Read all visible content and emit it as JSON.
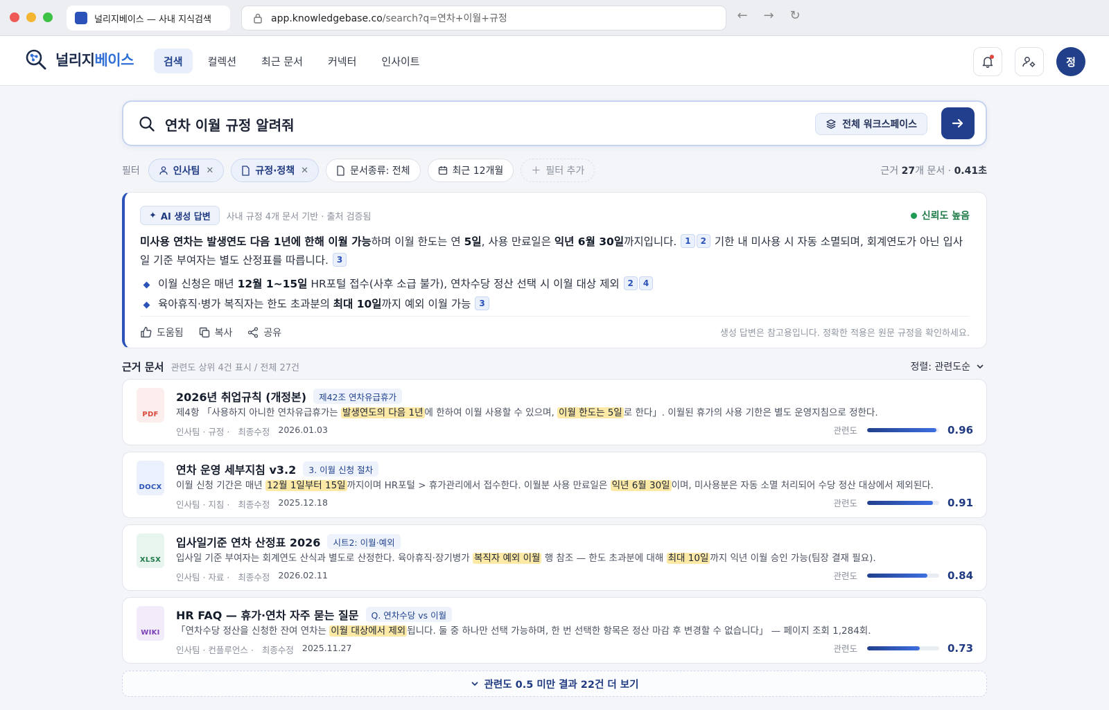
{
  "browser": {
    "tab_title": "널리지베이스 — 사내 지식검색",
    "url_host": "app.knowledgebase.co",
    "url_path": "/search?q=연차+이월+규정"
  },
  "app": {
    "logo_a": "널리지",
    "logo_b": "베이스",
    "nav": [
      "검색",
      "컬렉션",
      "최근 문서",
      "커넥터",
      "인사이트"
    ],
    "avatar_initial": "정"
  },
  "search": {
    "query": "연차 이월 규정 알려줘",
    "scope_label": "전체 워크스페이스"
  },
  "filters": {
    "label": "필터",
    "chips": [
      "인사팀",
      "규정·정책",
      "문서종류: 전체",
      "최근 12개월",
      "필터 추가"
    ],
    "meta_prefix": "근거 ",
    "meta_count": "27",
    "meta_mid": "개 문서 · ",
    "meta_time": "0.41초"
  },
  "ai": {
    "badge": "AI 생성 답변",
    "source": "사내 규정 4개 문서 기반 · 출처 검증됨",
    "confidence": "신뢰도 높음",
    "p": {
      "b1": "미사용 연차는 발생연도 다음 1년에 한해 이월 가능",
      "t1": "하며 이월 한도는 연 ",
      "b2": "5일",
      "t2": ", 사용 만료일은 ",
      "b3": "익년 6월 30일",
      "t3": "까지입니다.",
      "c1": "1",
      "c2": "2",
      "t4": " 기한 내 미사용 시 자동 소멸되며, 회계연도가 아닌 입사일 기준 부여자는 별도 산정표를 따릅니다.",
      "c3": "3"
    },
    "bullet1": {
      "t1": "이월 신청은 매년 ",
      "b1": "12월 1~15일",
      "t2": " HR포털 접수(사후 소급 불가), 연차수당 정산 선택 시 이월 대상 제외",
      "c1": "2",
      "c2": "4"
    },
    "bullet2": {
      "t1": "육아휴직·병가 복직자는 한도 초과분의 ",
      "b1": "최대 10일",
      "t2": "까지 예외 이월 가능",
      "c1": "3"
    },
    "actions": [
      "도움됨",
      "복사",
      "공유"
    ],
    "disclaimer": "생성 답변은 참고용입니다. 정확한 적용은 원문 규정을 확인하세요."
  },
  "docs_header": {
    "title": "근거 문서",
    "sub": "관련도 상위 4건 표시 / 전체 27건",
    "sort": "정렬: 관련도순"
  },
  "docs": [
    {
      "type": "PDF",
      "type_color": "#d9483b",
      "type_bg": "#fdeeee",
      "title": "2026년 취업규칙 (개정본)",
      "tag": "제42조 연차유급휴가",
      "s1": "제4항 「사용하지 아니한 연차유급휴가는 ",
      "h1": "발생연도의 다음 1년",
      "s2": "에 한하여 이월 사용할 수 있으며, ",
      "h2": "이월 한도는 5일",
      "s3": "로 한다」. 이월된 휴가의 사용 기한은 별도 운영지침으로 정한다.",
      "meta_dept": "인사팀 · 규정 ·",
      "meta_label": "최종수정",
      "date": "2026.01.03",
      "rel_label": "관련도",
      "score": "0.96",
      "relevance": 0.96
    },
    {
      "type": "DOCX",
      "type_color": "#2a52b8",
      "type_bg": "#eaf0fc",
      "title": "연차 운영 세부지침 v3.2",
      "tag": "3. 이월 신청 절차",
      "s1": "이월 신청 기간은 매년 ",
      "h1": "12월 1일부터 15일",
      "s2": "까지이며 HR포털 > 휴가관리에서 접수한다. 이월분 사용 만료일은 ",
      "h2": "익년 6월 30일",
      "s3": "이며, 미사용분은 자동 소멸 처리되어 수당 정산 대상에서 제외된다.",
      "meta_dept": "인사팀 · 지침 ·",
      "meta_label": "최종수정",
      "date": "2025.12.18",
      "rel_label": "관련도",
      "score": "0.91",
      "relevance": 0.91
    },
    {
      "type": "XLSX",
      "type_color": "#1e7b47",
      "type_bg": "#e8f5ee",
      "title": "입사일기준 연차 산정표 2026",
      "tag": "시트2: 이월·예외",
      "s1": "입사일 기준 부여자는 회계연도 산식과 별도로 산정한다. 육아휴직·장기병가 ",
      "h1": "복직자 예외 이월",
      "s2": " 행 참조 — 한도 초과분에 대해 ",
      "h2": "최대 10일",
      "s3": "까지 익년 이월 승인 가능(팀장 결재 필요).",
      "meta_dept": "인사팀 · 자료 ·",
      "meta_label": "최종수정",
      "date": "2026.02.11",
      "rel_label": "관련도",
      "score": "0.84",
      "relevance": 0.84
    },
    {
      "type": "WIKI",
      "type_color": "#7a3fb8",
      "type_bg": "#f2ebfa",
      "title": "HR FAQ — 휴가·연차 자주 묻는 질문",
      "tag": "Q. 연차수당 vs 이월",
      "s1": "「연차수당 정산을 신청한 잔여 연차는 ",
      "h1": "이월 대상에서 제외",
      "s2": "됩니다. 둘 중 하나만 선택 가능하며, 한 번 선택한 항목은 정산 마감 후 변경할 수 없습니다」 — 페이지 조회 1,284회.",
      "h2": "",
      "s3": "",
      "meta_dept": "인사팀 · 컨플루언스 ·",
      "meta_label": "최종수정",
      "date": "2025.11.27",
      "rel_label": "관련도",
      "score": "0.73",
      "relevance": 0.73
    }
  ],
  "more_button": "관련도 0.5 미만 결과 22건 더 보기"
}
